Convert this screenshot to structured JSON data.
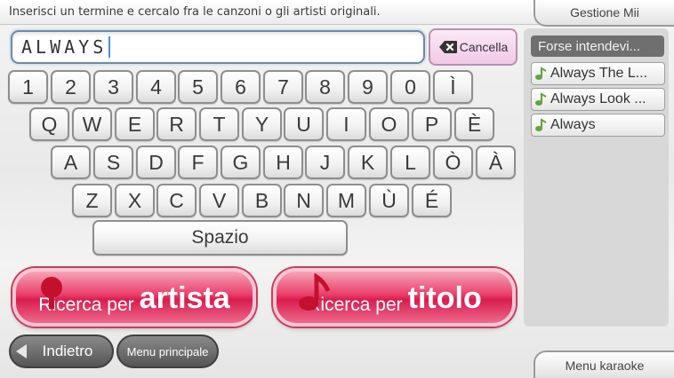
{
  "header": {
    "instruction": "Inserisci un termine e cercalo fra le canzoni o gli artisti originali.",
    "mii_button": "Gestione Mii"
  },
  "search": {
    "value": "ALWAYS",
    "clear_label": "Cancella"
  },
  "suggestions": {
    "title": "Forse intendevi...",
    "items": [
      {
        "label": "Always The L...",
        "icon": "music-note-icon"
      },
      {
        "label": "Always Look ...",
        "icon": "music-note-icon"
      },
      {
        "label": "Always",
        "icon": "music-note-icon"
      }
    ]
  },
  "keyboard": {
    "row1": [
      "1",
      "2",
      "3",
      "4",
      "5",
      "6",
      "7",
      "8",
      "9",
      "0",
      "Ì"
    ],
    "row2": [
      "Q",
      "W",
      "E",
      "R",
      "T",
      "Y",
      "U",
      "I",
      "O",
      "P",
      "È"
    ],
    "row3": [
      "A",
      "S",
      "D",
      "F",
      "G",
      "H",
      "J",
      "K",
      "L",
      "Ò",
      "À"
    ],
    "row4": [
      "Z",
      "X",
      "C",
      "V",
      "B",
      "N",
      "M",
      "Ù",
      "É"
    ],
    "space": "Spazio"
  },
  "actions": {
    "artist_prefix": "Ricerca per",
    "artist_main": "artista",
    "title_prefix": "Ricerca per",
    "title_main": "titolo"
  },
  "nav": {
    "back": "Indietro",
    "main_menu": "Menu principale",
    "karaoke_menu": "Menu karaoke"
  },
  "colors": {
    "accent_pink": "#e8325f",
    "clear_button": "#f1c8e6",
    "suggest_header": "#6f6f6f",
    "note_green": "#5fa53a"
  }
}
